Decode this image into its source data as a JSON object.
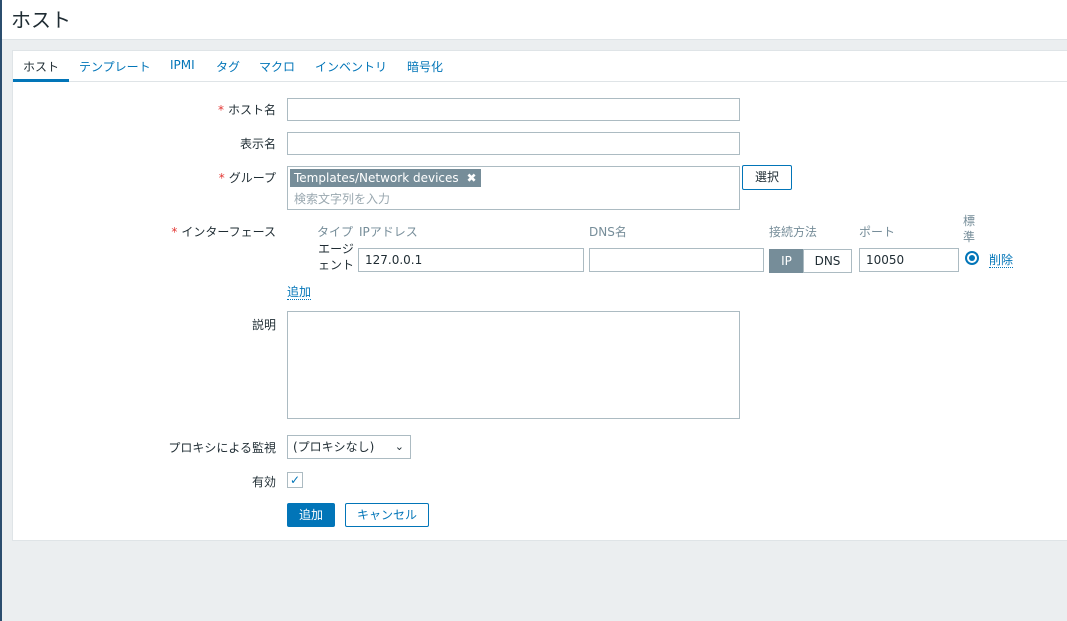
{
  "page": {
    "title": "ホスト"
  },
  "tabs": [
    {
      "label": "ホスト"
    },
    {
      "label": "テンプレート"
    },
    {
      "label": "IPMI"
    },
    {
      "label": "タグ"
    },
    {
      "label": "マクロ"
    },
    {
      "label": "インベントリ"
    },
    {
      "label": "暗号化"
    }
  ],
  "form": {
    "host_name": {
      "label": "ホスト名",
      "value": ""
    },
    "visible_name": {
      "label": "表示名",
      "value": ""
    },
    "groups": {
      "label": "グループ",
      "selected": [
        {
          "name": "Templates/Network devices",
          "remove_icon": "✖"
        }
      ],
      "placeholder": "検索文字列を入力",
      "select_button": "選択"
    },
    "interfaces": {
      "label": "インターフェース",
      "headers": {
        "type": "タイプ",
        "ip": "IPアドレス",
        "dns": "DNS名",
        "connect": "接続方法",
        "port": "ポート",
        "default": "標準"
      },
      "rows": [
        {
          "type": "エージェント",
          "ip": "127.0.0.1",
          "dns": "",
          "connect_options": [
            "IP",
            "DNS"
          ],
          "connect_selected": "IP",
          "port": "10050",
          "remove_label": "削除"
        }
      ],
      "add_label": "追加"
    },
    "description": {
      "label": "説明",
      "value": ""
    },
    "proxy": {
      "label": "プロキシによる監視",
      "selected": "(プロキシなし)"
    },
    "enabled": {
      "label": "有効",
      "checked": true,
      "check_glyph": "✓"
    },
    "buttons": {
      "add": "追加",
      "cancel": "キャンセル"
    }
  },
  "colors": {
    "accent": "#0275b8",
    "required": "#e33734",
    "chip": "#768d99",
    "background": "#ebeef0"
  },
  "icons": [
    "close-icon",
    "chevron-down-icon",
    "check-icon",
    "radio-icon"
  ]
}
